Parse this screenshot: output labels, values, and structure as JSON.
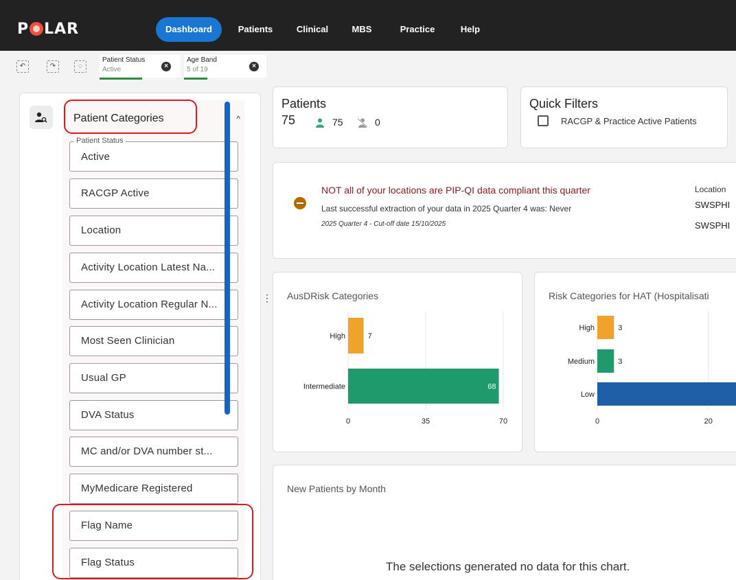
{
  "app": {
    "logo": "POLAR",
    "nav": [
      {
        "label": "Dashboard",
        "active": true
      },
      {
        "label": "Patients",
        "active": false
      },
      {
        "label": "Clinical",
        "active": false
      },
      {
        "label": "MBS",
        "active": false
      },
      {
        "label": "Practice",
        "active": false
      },
      {
        "label": "Help",
        "active": false
      }
    ]
  },
  "toolbar": {
    "icons": [
      "undo-selection-icon",
      "redo-selection-icon",
      "clear-selections-icon"
    ]
  },
  "filters": [
    {
      "title": "Patient Status",
      "value": "Active"
    },
    {
      "title": "Age Band",
      "value": "5 of 19"
    }
  ],
  "sidebar": {
    "category": "Patient Categories",
    "chevron": "^",
    "items": [
      {
        "label": "Active",
        "legend": "Patient Status"
      },
      {
        "label": "RACGP Active"
      },
      {
        "label": "Location"
      },
      {
        "label": "Activity Location Latest Na..."
      },
      {
        "label": "Activity Location Regular N..."
      },
      {
        "label": "Most Seen Clinician"
      },
      {
        "label": "Usual GP"
      },
      {
        "label": "DVA Status"
      },
      {
        "label": "MC and/or DVA number st..."
      },
      {
        "label": "MyMedicare Registered"
      },
      {
        "label": "Flag Name"
      },
      {
        "label": "Flag Status"
      }
    ]
  },
  "patients_card": {
    "title": "Patients",
    "total": "75",
    "active": "75",
    "inactive": "0"
  },
  "quick_filters": {
    "title": "Quick Filters",
    "option": "RACGP & Practice Active Patients",
    "checked": false
  },
  "compliance": {
    "warning": "NOT all of your locations are PIP-QI data compliant this quarter",
    "extraction": "Last successful extraction of your data in 2025 Quarter 4 was: Never",
    "cutoff": "2025 Quarter 4 - Cut-off date 15/10/2025",
    "location_title": "Location",
    "locations": [
      "SWSPHI",
      "SWSPHI"
    ]
  },
  "chart_data": [
    {
      "type": "bar",
      "orientation": "horizontal",
      "title": "AusDRisk Categories",
      "categories": [
        "High",
        "Intermediate"
      ],
      "values": [
        7,
        68
      ],
      "colors": [
        "#f0a32a",
        "#1f9a6c"
      ],
      "xticks": [
        "0",
        "35",
        "70"
      ],
      "xlim": [
        0,
        70
      ]
    },
    {
      "type": "bar",
      "orientation": "horizontal",
      "title": "Risk Categories for HAT (Hospitalisati",
      "categories": [
        "High",
        "Medium",
        "Low"
      ],
      "values": [
        3,
        3,
        69
      ],
      "labels": [
        "3",
        "3",
        ""
      ],
      "colors": [
        "#f0a32a",
        "#1f9a6c",
        "#1f5fa8"
      ],
      "xticks": [
        "0",
        "20"
      ],
      "xlim": [
        0,
        70
      ]
    }
  ],
  "new_patients": {
    "title": "New Patients by Month",
    "empty_message": "The selections generated no data for this chart."
  }
}
